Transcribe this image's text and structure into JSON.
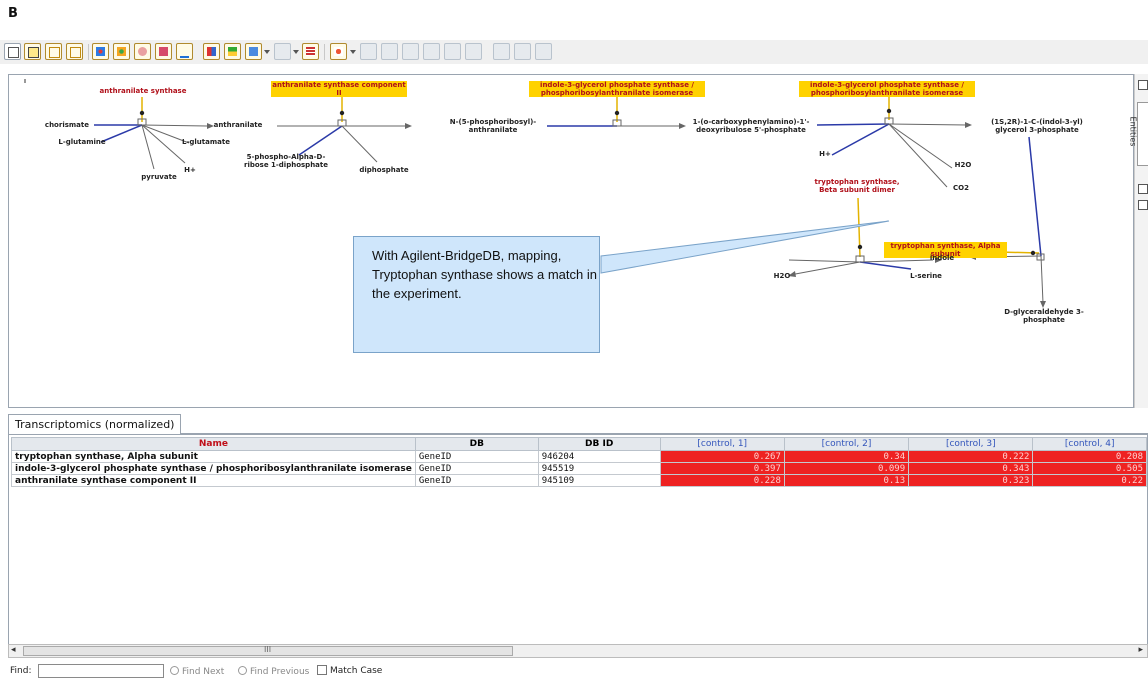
{
  "figure_label": "B",
  "pathway": {
    "genes": [
      {
        "label": "anthranilate synthase",
        "highlight": false
      },
      {
        "label": "anthranilate synthase component II",
        "highlight": true
      },
      {
        "label": "indole-3-glycerol phosphate synthase / phosphoribosylanthranilate isomerase",
        "highlight": true
      },
      {
        "label": "indole-3-glycerol phosphate synthase / phosphoribosylanthranilate isomerase",
        "highlight": true
      },
      {
        "label": "tryptophan synthase, Beta subunit dimer",
        "highlight": false
      },
      {
        "label": "tryptophan synthase, Alpha subunit",
        "highlight": true
      }
    ],
    "metabolites": {
      "chorismate": "chorismate",
      "l_glutamine": "L-glutamine",
      "pyruvate": "pyruvate",
      "anthranilate": "anthranilate",
      "l_glutamate": "L-glutamate",
      "h_plus_1": "H+",
      "prpp": "5-phospho-Alpha-D-ribose 1-diphosphate",
      "diphosphate": "diphosphate",
      "n_5_phosphoribosyl": "N-(5-phosphoribosyl)-anthranilate",
      "cdrp": "1-(o-carboxyphenylamino)-1'-deoxyribulose 5'-phosphate",
      "h_plus_2": "H+",
      "h2o_1": "H2O",
      "co2": "CO2",
      "igp": "(1S,2R)-1-C-(indol-3-yl) glycerol 3-phosphate",
      "indole": "indole",
      "h2o_2": "H2O",
      "l_serine": "L-serine",
      "g3p": "D-glyceraldehyde 3-phosphate"
    },
    "side_tab_label": "Entities"
  },
  "callout": {
    "text": "With Agilent-BridgeDB, mapping, Tryptophan synthase shows a match in the experiment."
  },
  "data_panel": {
    "tab_label": "Transcriptomics (normalized)",
    "columns": [
      "Name",
      "DB",
      "DB ID",
      "[control, 1]",
      "[control, 2]",
      "[control, 3]",
      "[control, 4]"
    ],
    "rows": [
      {
        "name": "tryptophan synthase, Alpha subunit",
        "db": "GeneID",
        "db_id": "946204",
        "c1": "0.267",
        "c2": "0.34",
        "c3": "0.222",
        "c4": "0.208"
      },
      {
        "name": "indole-3-glycerol phosphate synthase / phosphoribosylanthranilate isomerase",
        "db": "GeneID",
        "db_id": "945519",
        "c1": "0.397",
        "c2": "0.099",
        "c3": "0.343",
        "c4": "0.505"
      },
      {
        "name": "anthranilate synthase component II",
        "db": "GeneID",
        "db_id": "945109",
        "c1": "0.228",
        "c2": "0.13",
        "c3": "0.323",
        "c4": "0.22"
      }
    ],
    "value_cell_color": "#ee2222"
  },
  "scrollbar": {
    "grip": "III"
  },
  "find_bar": {
    "label": "Find:",
    "input_value": "",
    "find_next": "Find Next",
    "find_previous": "Find Previous",
    "match_case": "Match Case"
  },
  "colors": {
    "highlight": "#ffd200",
    "gene_text": "#b0101a",
    "callout_bg": "#cfe6fb",
    "edge_blue": "#2b3aa8"
  }
}
